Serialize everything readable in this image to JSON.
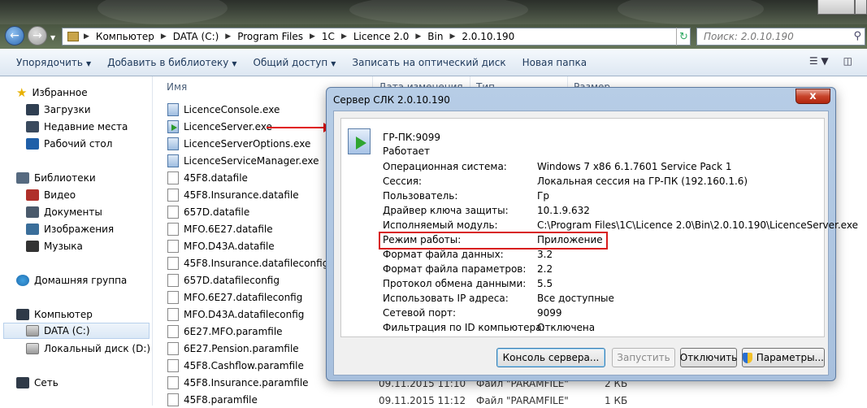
{
  "address": {
    "crumbs": [
      "Компьютер",
      "DATA (C:)",
      "Program Files",
      "1C",
      "Licence 2.0",
      "Bin",
      "2.0.10.190"
    ],
    "search_placeholder": "Поиск: 2.0.10.190"
  },
  "toolbar": {
    "organize": "Упорядочить",
    "add_library": "Добавить в библиотеку",
    "share": "Общий доступ",
    "burn": "Записать на оптический диск",
    "new_folder": "Новая папка"
  },
  "nav": {
    "favorites": "Избранное",
    "downloads": "Загрузки",
    "recent": "Недавние места",
    "desktop": "Рабочий стол",
    "libraries": "Библиотеки",
    "video": "Видео",
    "documents": "Документы",
    "images": "Изображения",
    "music": "Музыка",
    "homegroup": "Домашняя группа",
    "computer": "Компьютер",
    "drive_c": "DATA (C:)",
    "drive_d": "Локальный диск (D:)",
    "network": "Сеть"
  },
  "columns": {
    "name": "Имя",
    "date": "Дата изменения",
    "type": "Тип",
    "size": "Размер"
  },
  "files": [
    "LicenceConsole.exe",
    "LicenceServer.exe",
    "LicenceServerOptions.exe",
    "LicenceServiceManager.exe",
    "45F8.datafile",
    "45F8.Insurance.datafile",
    "657D.datafile",
    "MFO.6E27.datafile",
    "MFO.D43A.datafile",
    "45F8.Insurance.datafileconfig",
    "657D.datafileconfig",
    "MFO.6E27.datafileconfig",
    "MFO.D43A.datafileconfig",
    "6E27.MFO.paramfile",
    "6E27.Pension.paramfile",
    "45F8.Cashflow.paramfile",
    "45F8.Insurance.paramfile",
    "45F8.paramfile"
  ],
  "visible_rows": {
    "row1": {
      "date": "09.11.2015 11:10",
      "type": "Файл \"PARAMFILE\"",
      "size": "2 КБ"
    },
    "row2": {
      "date": "09.11.2015 11:12",
      "type": "Файл \"PARAMFILE\"",
      "size": "1 КБ"
    }
  },
  "dialog": {
    "title": "Сервер СЛК 2.0.10.190",
    "close": "x",
    "server_name": "ГР-ПК:9099",
    "server_state": "Работает",
    "props": [
      {
        "label": "Операционная система:",
        "value": "Windows 7 x86 6.1.7601 Service Pack 1"
      },
      {
        "label": "Сессия:",
        "value": "Локальная сессия на ГР-ПК (192.160.1.6)"
      },
      {
        "label": "Пользователь:",
        "value": "Гр"
      },
      {
        "label": "Драйвер ключа защиты:",
        "value": "10.1.9.632"
      },
      {
        "label": "Исполняемый модуль:",
        "value": "C:\\Program Files\\1C\\Licence 2.0\\Bin\\2.0.10.190\\LicenceServer.exe"
      },
      {
        "label": "Режим работы:",
        "value": "Приложение"
      },
      {
        "label": "Формат файла данных:",
        "value": "3.2"
      },
      {
        "label": "Формат файла параметров:",
        "value": "2.2"
      },
      {
        "label": "Протокол обмена данными:",
        "value": "5.5"
      },
      {
        "label": "Использовать IP адреса:",
        "value": "Все доступные"
      },
      {
        "label": "Сетевой порт:",
        "value": "9099"
      },
      {
        "label": "Фильтрация по ID компьютера:",
        "value": "Отключена"
      }
    ],
    "buttons": {
      "console": "Консоль сервера...",
      "start": "Запустить",
      "disconnect": "Отключить",
      "params": "Параметры..."
    }
  }
}
